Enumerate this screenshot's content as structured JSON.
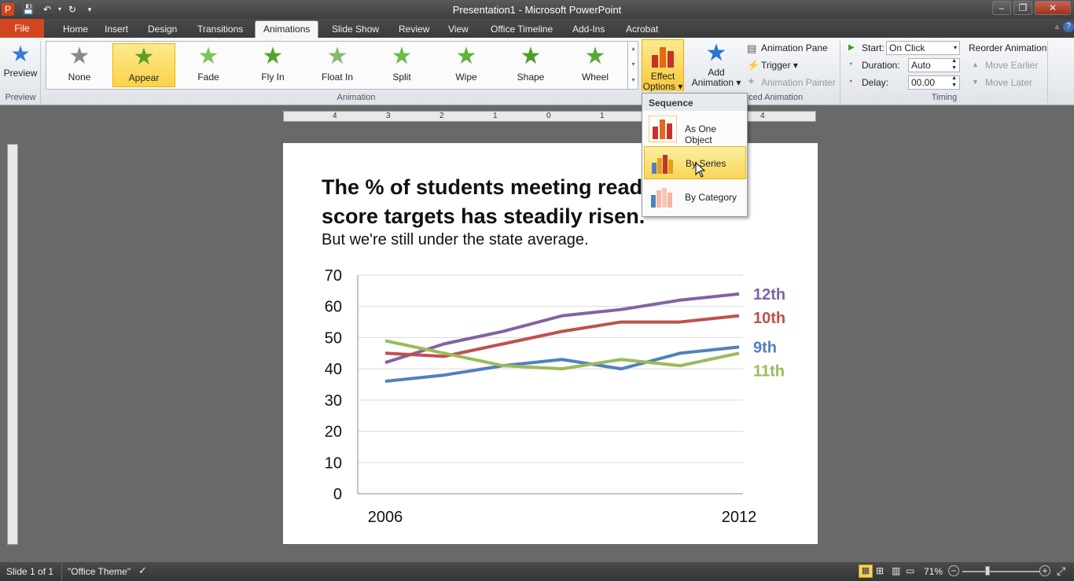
{
  "window": {
    "title": "Presentation1 - Microsoft PowerPoint",
    "minimize": "–",
    "maximize": "❐",
    "close": "✕"
  },
  "tabs": [
    {
      "label": "File"
    },
    {
      "label": "Home"
    },
    {
      "label": "Insert"
    },
    {
      "label": "Design"
    },
    {
      "label": "Transitions"
    },
    {
      "label": "Animations"
    },
    {
      "label": "Slide Show"
    },
    {
      "label": "Review"
    },
    {
      "label": "View"
    },
    {
      "label": "Office Timeline"
    },
    {
      "label": "Add-Ins"
    },
    {
      "label": "Acrobat"
    }
  ],
  "ribbon": {
    "preview": {
      "button": "Preview",
      "group": "Preview"
    },
    "animation_group": "Animation",
    "animations": [
      {
        "label": "None",
        "color": "#8a8a8a"
      },
      {
        "label": "Appear",
        "color": "#5aa02c",
        "selected": true
      },
      {
        "label": "Fade",
        "color": "#7cc35a"
      },
      {
        "label": "Fly In",
        "color": "#4fa52f"
      },
      {
        "label": "Float In",
        "color": "#88b870"
      },
      {
        "label": "Split",
        "color": "#6cbc48"
      },
      {
        "label": "Wipe",
        "color": "#5fb33a"
      },
      {
        "label": "Shape",
        "color": "#4d9e2a"
      },
      {
        "label": "Wheel",
        "color": "#58aa34"
      }
    ],
    "effect_options": {
      "line1": "Effect",
      "line2": "Options ▾"
    },
    "add_animation": {
      "line1": "Add",
      "line2": "Animation ▾"
    },
    "advanced": {
      "animation_pane": "Animation Pane",
      "trigger": "Trigger ▾",
      "animation_painter": "Animation Painter",
      "group": "ced Animation"
    },
    "timing": {
      "start_label": "Start:",
      "start_value": "On Click",
      "duration_label": "Duration:",
      "duration_value": "Auto",
      "delay_label": "Delay:",
      "delay_value": "00.00",
      "reorder": "Reorder Animation",
      "move_earlier": "Move Earlier",
      "move_later": "Move Later",
      "group": "Timing"
    }
  },
  "dropdown": {
    "header": "Sequence",
    "items": [
      {
        "label": "As One Object",
        "highlighted": false
      },
      {
        "label": "By Series",
        "highlighted": true
      },
      {
        "label": "By Category",
        "highlighted": false
      }
    ]
  },
  "slide": {
    "title_line1": "The % of students meeting readi",
    "title_line2": "score targets has steadily risen.",
    "subtitle": "But we're still under the state average."
  },
  "ruler": {
    "h_ticks": [
      "4",
      "3",
      "2",
      "1",
      "0",
      "1",
      "2",
      "3",
      "4"
    ]
  },
  "chart_data": {
    "type": "line",
    "x": [
      2006,
      2007,
      2008,
      2009,
      2010,
      2011,
      2012
    ],
    "x_tick_labels": [
      "2006",
      "2012"
    ],
    "y_ticks": [
      "0",
      "10",
      "20",
      "30",
      "40",
      "50",
      "60",
      "70"
    ],
    "ylim": [
      0,
      70
    ],
    "grid": true,
    "series": [
      {
        "name": "12th",
        "color": "#8064a2",
        "values": [
          42,
          48,
          52,
          57,
          59,
          62,
          64
        ]
      },
      {
        "name": "10th",
        "color": "#c0504d",
        "values": [
          45,
          44,
          48,
          52,
          55,
          55,
          57
        ]
      },
      {
        "name": "9th",
        "color": "#4f81bd",
        "values": [
          36,
          38,
          41,
          43,
          40,
          45,
          47
        ]
      },
      {
        "name": "11th",
        "color": "#9bbb59",
        "values": [
          49,
          45,
          41,
          40,
          43,
          41,
          45
        ]
      }
    ]
  },
  "status": {
    "slide": "Slide 1 of 1",
    "theme": "\"Office Theme\"",
    "zoom": "71%"
  }
}
